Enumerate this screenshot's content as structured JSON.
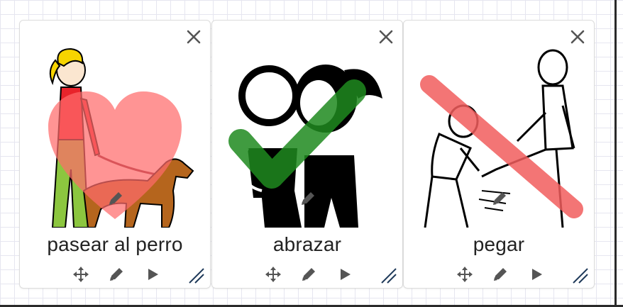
{
  "cards": [
    {
      "label": "pasear al perro",
      "icon": "walk-dog-pictogram",
      "overlay": "heart"
    },
    {
      "label": "abrazar",
      "icon": "hug-pictogram",
      "overlay": "checkmark"
    },
    {
      "label": "pegar",
      "icon": "hit-pictogram",
      "overlay": "prohibited-slash"
    }
  ],
  "colors": {
    "heart": "#ff6b6b",
    "check": "#1e8a1e",
    "slash": "#f25d5d",
    "icon": "#555555",
    "resize": "#1f3a5a"
  }
}
